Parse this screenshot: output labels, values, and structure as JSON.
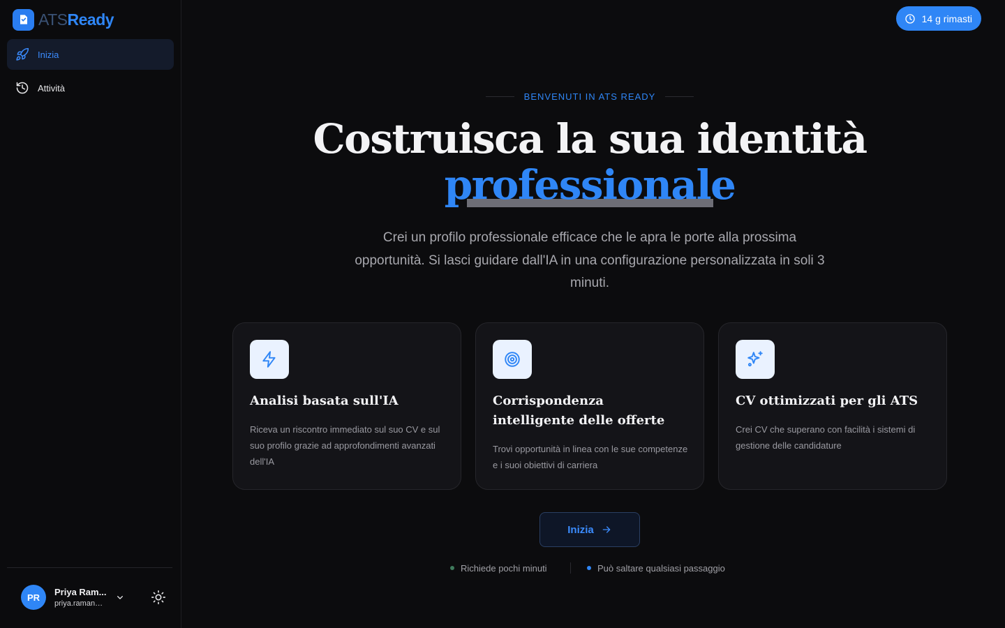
{
  "brand": {
    "name_part1": "ATS",
    "name_part2": "Ready"
  },
  "sidebar": {
    "items": [
      {
        "label": "Inizia",
        "icon": "rocket-icon",
        "active": true
      },
      {
        "label": "Attività",
        "icon": "history-icon",
        "active": false
      }
    ]
  },
  "user": {
    "initials": "PR",
    "name": "Priya Ram...",
    "email": "priya.raman@..."
  },
  "trial": {
    "label": "14 g rimasti",
    "icon": "clock-icon"
  },
  "hero": {
    "eyebrow": "BENVENUTI IN ATS READY",
    "title_line1": "Costruisca la sua identità",
    "title_accent": "professionale",
    "lead": "Crei un profilo professionale efficace che le apra le porte alla prossima opportunità. Si lasci guidare dall'IA in una configurazione personalizzata in soli 3 minuti."
  },
  "features": [
    {
      "icon": "lightning-icon",
      "title": "Analisi basata sull'IA",
      "description": "Riceva un riscontro immediato sul suo CV e sul suo profilo grazie ad approfondimenti avanzati dell'IA"
    },
    {
      "icon": "target-icon",
      "title": "Corrispondenza intelligente delle offerte",
      "description": "Trovi opportunità in linea con le sue competenze e i suoi obiettivi di carriera"
    },
    {
      "icon": "sparkles-icon",
      "title": "CV ottimizzati per gli ATS",
      "description": "Crei CV che superano con facilità i sistemi di gestione delle candidature"
    }
  ],
  "cta": {
    "label": "Inizia"
  },
  "notes": [
    {
      "text": "Richiede pochi minuti",
      "dot_color": "#3f7a5c"
    },
    {
      "text": "Può saltare qualsiasi passaggio",
      "dot_color": "#2f86f6"
    }
  ],
  "colors": {
    "accent": "#2f86f6",
    "background": "#0c0c0e",
    "card": "#141418"
  }
}
